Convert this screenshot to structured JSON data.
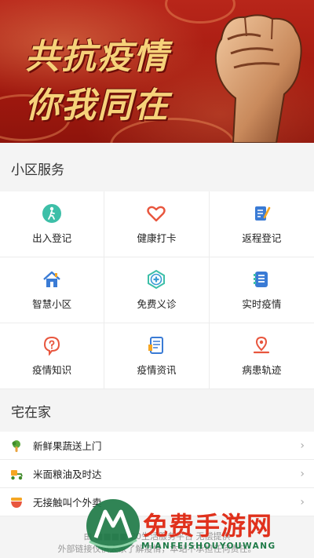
{
  "banner": {
    "line1": "共抗疫情",
    "line2": "你我同在"
  },
  "community": {
    "title": "小区服务",
    "items": [
      {
        "label": "出入登记",
        "icon": "person-walk-icon"
      },
      {
        "label": "健康打卡",
        "icon": "heart-icon"
      },
      {
        "label": "返程登记",
        "icon": "edit-note-icon"
      },
      {
        "label": "智慧小区",
        "icon": "house-icon"
      },
      {
        "label": "免费义诊",
        "icon": "medical-cross-icon"
      },
      {
        "label": "实时疫情",
        "icon": "report-list-icon"
      },
      {
        "label": "疫情知识",
        "icon": "question-icon"
      },
      {
        "label": "疫情资讯",
        "icon": "news-doc-icon"
      },
      {
        "label": "病患轨迹",
        "icon": "location-pin-icon"
      }
    ]
  },
  "home": {
    "title": "宅在家",
    "items": [
      {
        "label": "新鲜果蔬送上门",
        "icon": "vegetable-icon"
      },
      {
        "label": "米面粮油及时达",
        "icon": "delivery-scooter-icon"
      },
      {
        "label": "无接触叫个外卖",
        "icon": "food-bowl-icon"
      }
    ]
  },
  "footer": {
    "line1": "由 ■■■■ 20生活服务平台 无偿提供",
    "line2": "外部链接仅供大家了解疫情，本站不承担任何责任。"
  },
  "watermark": {
    "text": "免费手游网",
    "sub": "MIANFEISHOUYOUWANG"
  },
  "colors": {
    "accent": "#e8563e",
    "brand_red": "#b8261a",
    "green": "#1e7a47",
    "blue": "#3a7bd5"
  }
}
